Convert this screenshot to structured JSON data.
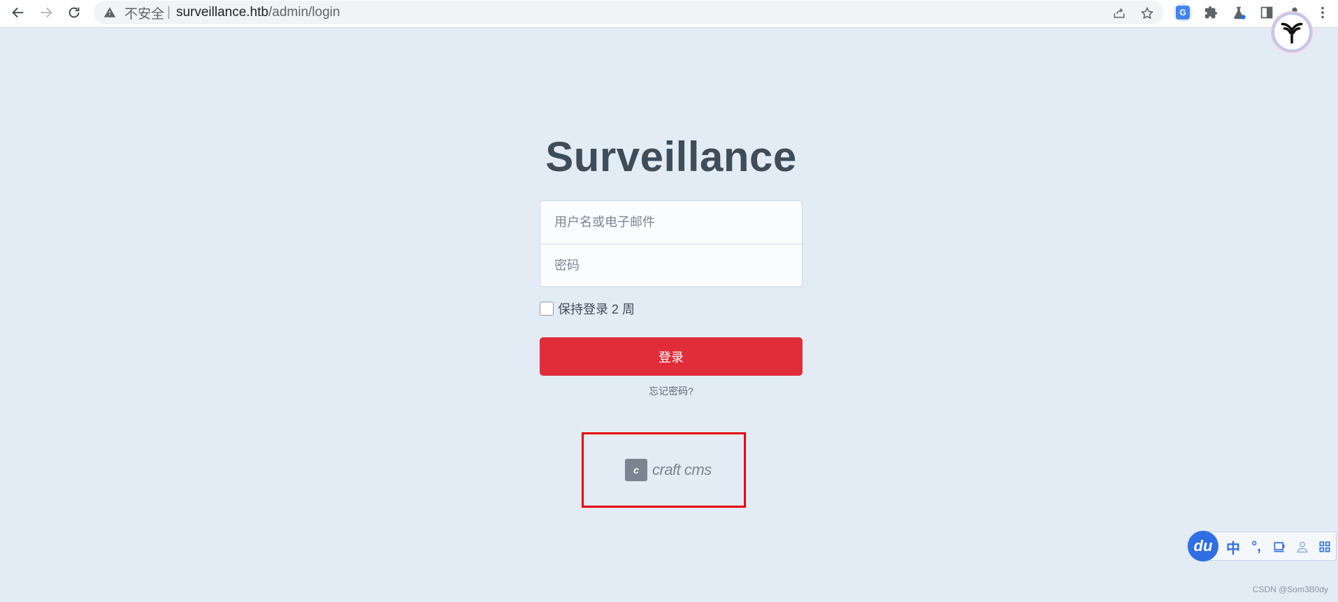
{
  "browser": {
    "security_label": "不安全",
    "url_host": "surveillance.htb",
    "url_path": "/admin/login",
    "icons": [
      "back-icon",
      "forward-icon",
      "reload-icon",
      "warning-icon",
      "share-icon",
      "star-icon",
      "translate-icon",
      "puzzle-icon",
      "lab-flask-icon",
      "side-panel-icon",
      "profile-icon",
      "menu-kebab-icon"
    ]
  },
  "login": {
    "title": "Surveillance",
    "username_placeholder": "用户名或电子邮件",
    "password_placeholder": "密码",
    "remember_label": "保持登录 2 周",
    "submit_label": "登录",
    "forgot_label": "忘记密码?",
    "powered_by_logo": "craft cms"
  },
  "ime_toolbar": {
    "brand": "du",
    "mode_label": "中",
    "punct_label": "°,"
  },
  "watermark": "CSDN @Som3B0dy",
  "colors": {
    "page_bg": "#e3ebf5",
    "submit_bg": "#e12d39",
    "title_color": "#3f4d5a",
    "highlight_box": "#e60000"
  }
}
